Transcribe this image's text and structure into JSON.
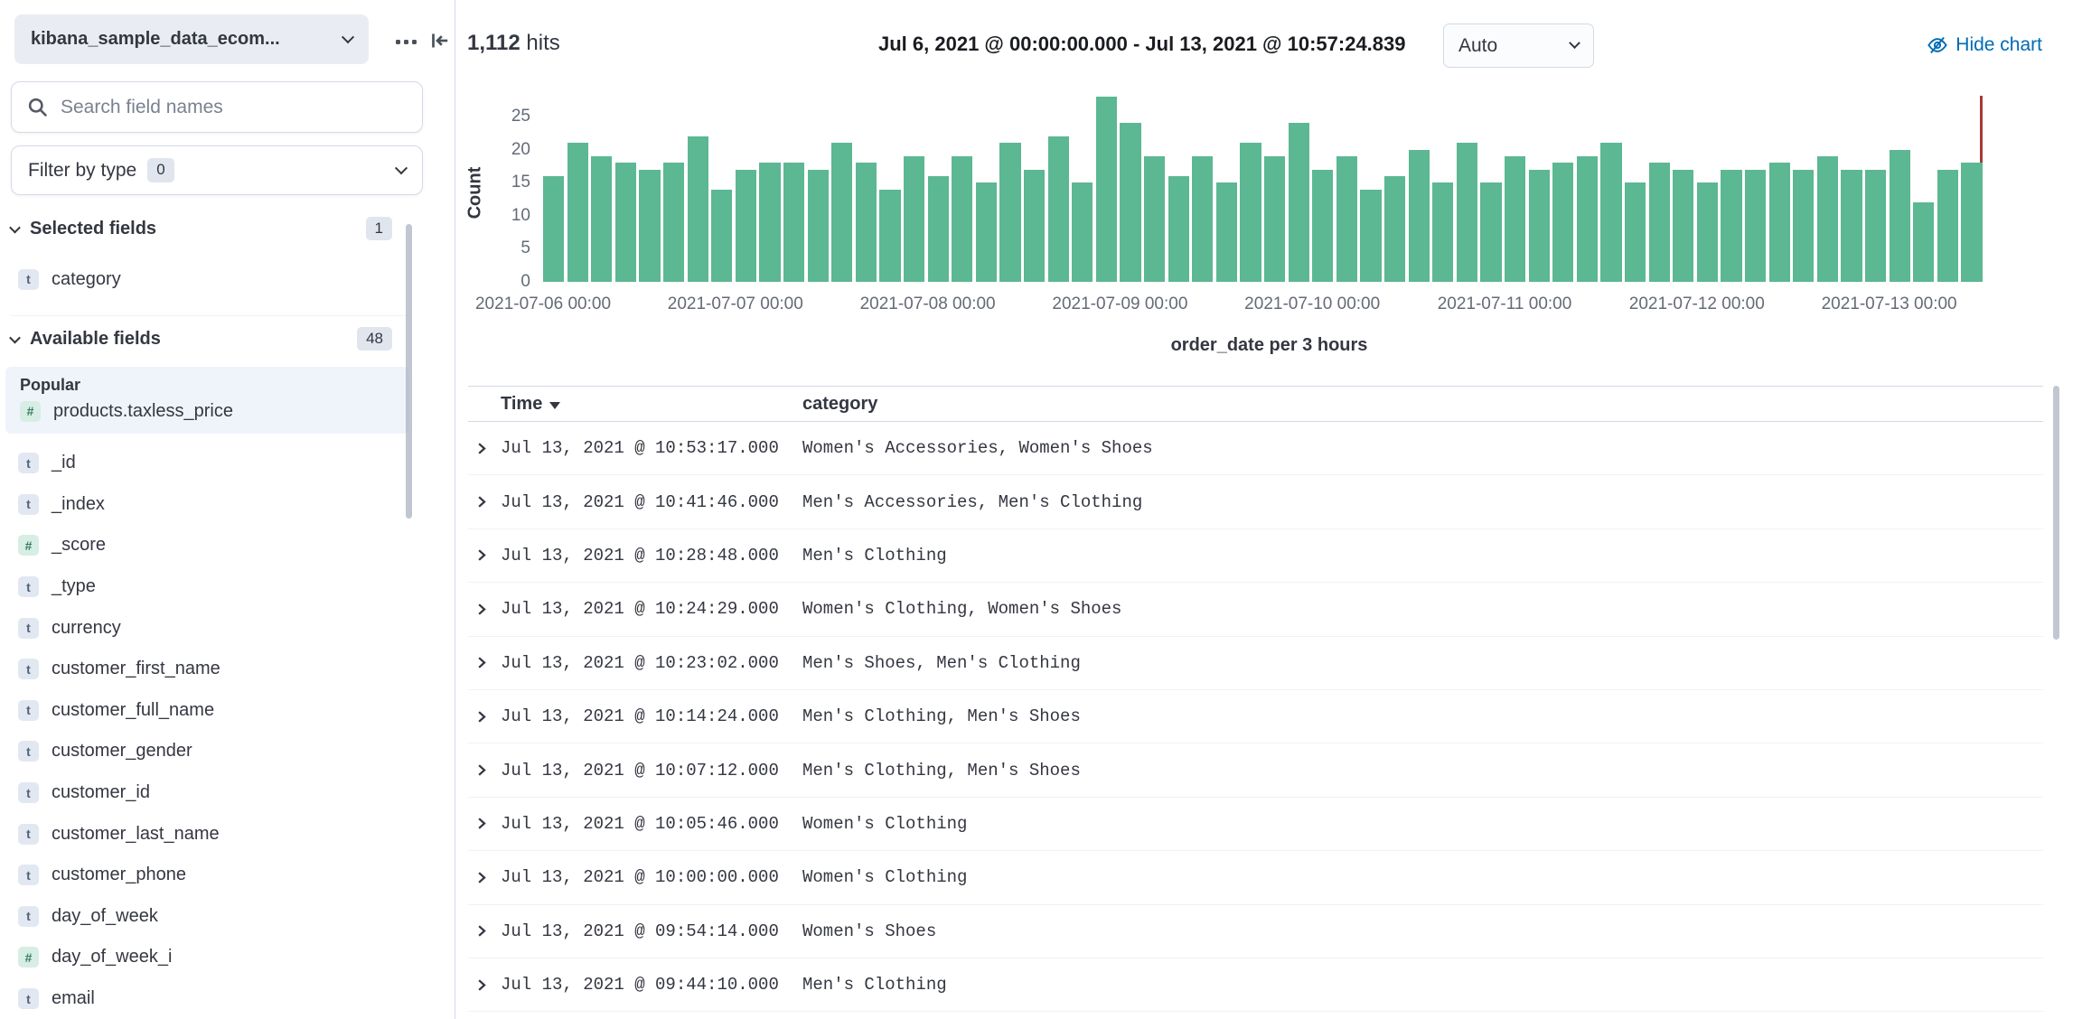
{
  "sidebar": {
    "index_pattern_label": "kibana_sample_data_ecom...",
    "search": {
      "placeholder": "Search field names"
    },
    "filter_by_type": {
      "label": "Filter by type",
      "count": "0"
    },
    "selected_fields": {
      "label": "Selected fields",
      "count": "1",
      "items": [
        {
          "type": "t",
          "name": "category"
        }
      ]
    },
    "available_fields": {
      "label": "Available fields",
      "count": "48"
    },
    "popular": {
      "label": "Popular",
      "items": [
        {
          "type": "#",
          "name": "products.taxless_price"
        }
      ]
    },
    "fields": [
      {
        "type": "t",
        "name": "_id"
      },
      {
        "type": "t",
        "name": "_index"
      },
      {
        "type": "#",
        "name": "_score"
      },
      {
        "type": "t",
        "name": "_type"
      },
      {
        "type": "t",
        "name": "currency"
      },
      {
        "type": "t",
        "name": "customer_first_name"
      },
      {
        "type": "t",
        "name": "customer_full_name"
      },
      {
        "type": "t",
        "name": "customer_gender"
      },
      {
        "type": "t",
        "name": "customer_id"
      },
      {
        "type": "t",
        "name": "customer_last_name"
      },
      {
        "type": "t",
        "name": "customer_phone"
      },
      {
        "type": "t",
        "name": "day_of_week"
      },
      {
        "type": "#",
        "name": "day_of_week_i"
      },
      {
        "type": "t",
        "name": "email"
      }
    ]
  },
  "header": {
    "hits_value": "1,112",
    "hits_label": "hits",
    "time_range": "Jul 6, 2021 @ 00:00:00.000 - Jul 13, 2021 @ 10:57:24.839",
    "interval_selected": "Auto",
    "hide_chart_label": "Hide chart"
  },
  "chart_data": {
    "type": "bar",
    "title": "",
    "xlabel": "order_date per 3 hours",
    "ylabel": "Count",
    "ylim": [
      0,
      28
    ],
    "y_ticks": [
      0,
      5,
      10,
      15,
      20,
      25
    ],
    "x_ticks": [
      "2021-07-06 00:00",
      "2021-07-07 00:00",
      "2021-07-08 00:00",
      "2021-07-09 00:00",
      "2021-07-10 00:00",
      "2021-07-11 00:00",
      "2021-07-12 00:00",
      "2021-07-13 00:00"
    ],
    "interval": "3h",
    "values": [
      16,
      21,
      19,
      18,
      17,
      18,
      22,
      14,
      17,
      18,
      18,
      17,
      21,
      18,
      14,
      19,
      16,
      19,
      15,
      21,
      17,
      22,
      15,
      28,
      24,
      19,
      16,
      19,
      15,
      21,
      19,
      24,
      17,
      19,
      14,
      16,
      20,
      15,
      21,
      15,
      19,
      17,
      18,
      19,
      21,
      15,
      18,
      17,
      15,
      17,
      17,
      18,
      17,
      19,
      17,
      17,
      20,
      12,
      17,
      18
    ],
    "bar_color": "#5CB793",
    "time_marker_color": "#A73A33",
    "grid": false,
    "legend": "none"
  },
  "table": {
    "columns": [
      "Time",
      "category"
    ],
    "sort": {
      "column": "Time",
      "direction": "desc"
    },
    "rows": [
      {
        "time": "Jul 13, 2021 @ 10:53:17.000",
        "category": "Women's Accessories, Women's Shoes"
      },
      {
        "time": "Jul 13, 2021 @ 10:41:46.000",
        "category": "Men's Accessories, Men's Clothing"
      },
      {
        "time": "Jul 13, 2021 @ 10:28:48.000",
        "category": "Men's Clothing"
      },
      {
        "time": "Jul 13, 2021 @ 10:24:29.000",
        "category": "Women's Clothing, Women's Shoes"
      },
      {
        "time": "Jul 13, 2021 @ 10:23:02.000",
        "category": "Men's Shoes, Men's Clothing"
      },
      {
        "time": "Jul 13, 2021 @ 10:14:24.000",
        "category": "Men's Clothing, Men's Shoes"
      },
      {
        "time": "Jul 13, 2021 @ 10:07:12.000",
        "category": "Men's Clothing, Men's Shoes"
      },
      {
        "time": "Jul 13, 2021 @ 10:05:46.000",
        "category": "Women's Clothing"
      },
      {
        "time": "Jul 13, 2021 @ 10:00:00.000",
        "category": "Women's Clothing"
      },
      {
        "time": "Jul 13, 2021 @ 09:54:14.000",
        "category": "Women's Shoes"
      },
      {
        "time": "Jul 13, 2021 @ 09:44:10.000",
        "category": "Men's Clothing"
      }
    ]
  }
}
